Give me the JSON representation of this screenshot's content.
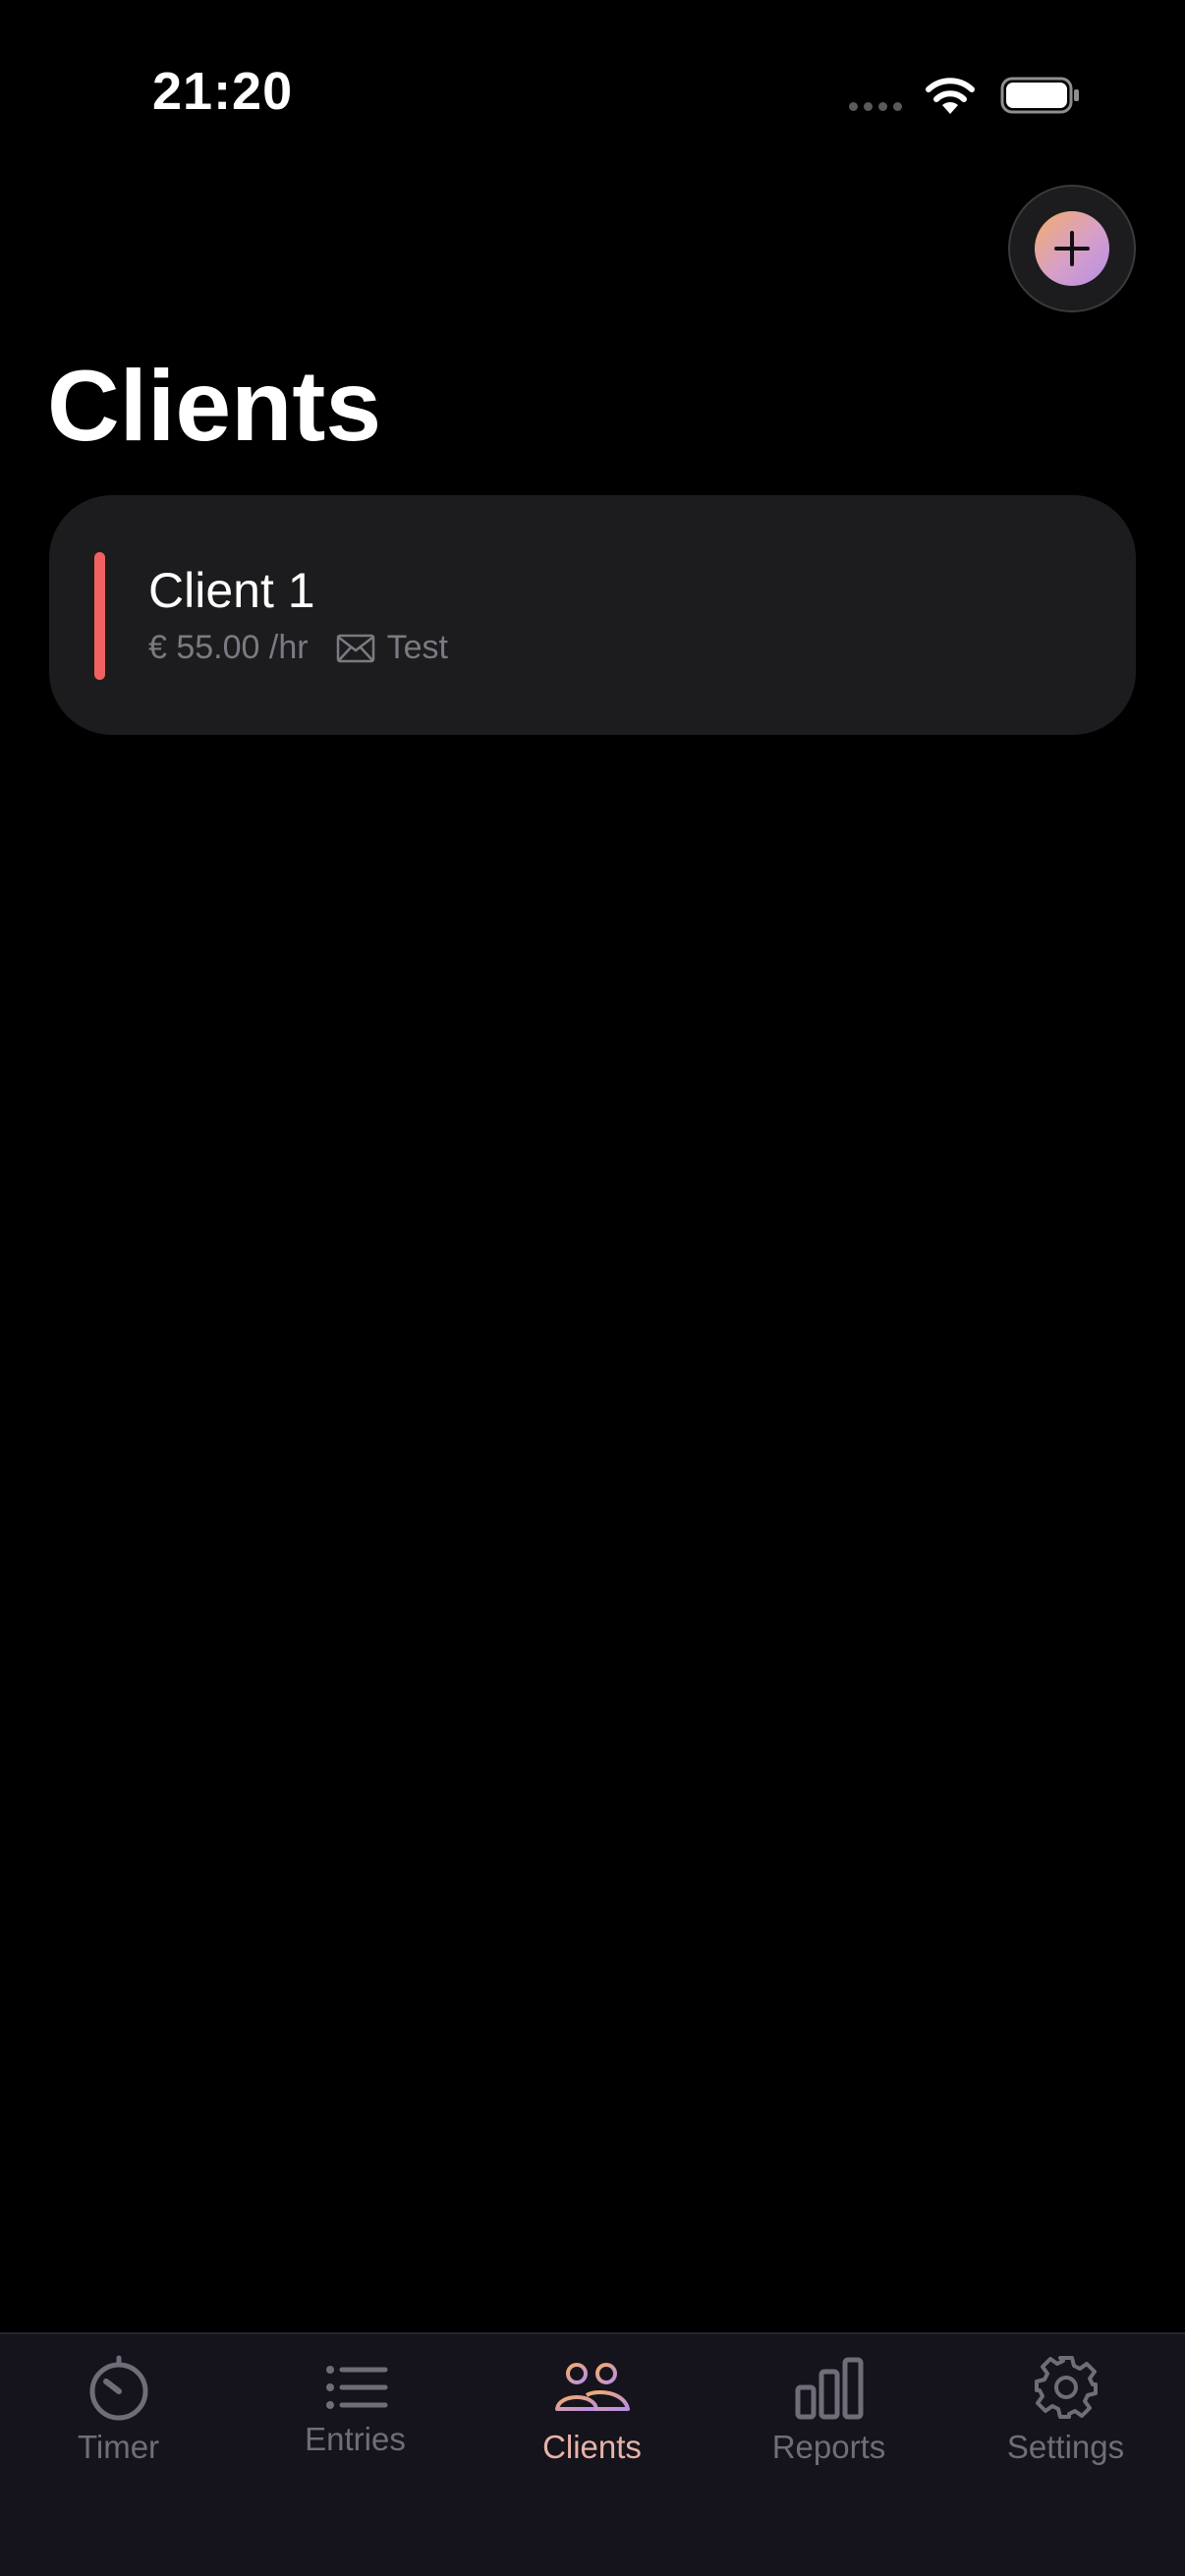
{
  "status_bar": {
    "time": "21:20"
  },
  "header": {
    "title": "Clients",
    "add_icon": "plus-icon"
  },
  "clients": [
    {
      "name": "Client 1",
      "rate": "€ 55.00 /hr",
      "email_label": "Test",
      "color": "#f06262"
    }
  ],
  "tab_bar": {
    "active": "Clients",
    "tabs": [
      {
        "label": "Timer",
        "icon": "timer-icon"
      },
      {
        "label": "Entries",
        "icon": "list-icon"
      },
      {
        "label": "Clients",
        "icon": "people-icon"
      },
      {
        "label": "Reports",
        "icon": "bar-chart-icon"
      },
      {
        "label": "Settings",
        "icon": "gear-icon"
      }
    ]
  },
  "colors": {
    "background": "#000000",
    "card": "#1c1c1e",
    "accent_gradient_start": "#f3ad6b",
    "accent_gradient_end": "#b78ee6",
    "tab_inactive": "#6e6e78"
  }
}
